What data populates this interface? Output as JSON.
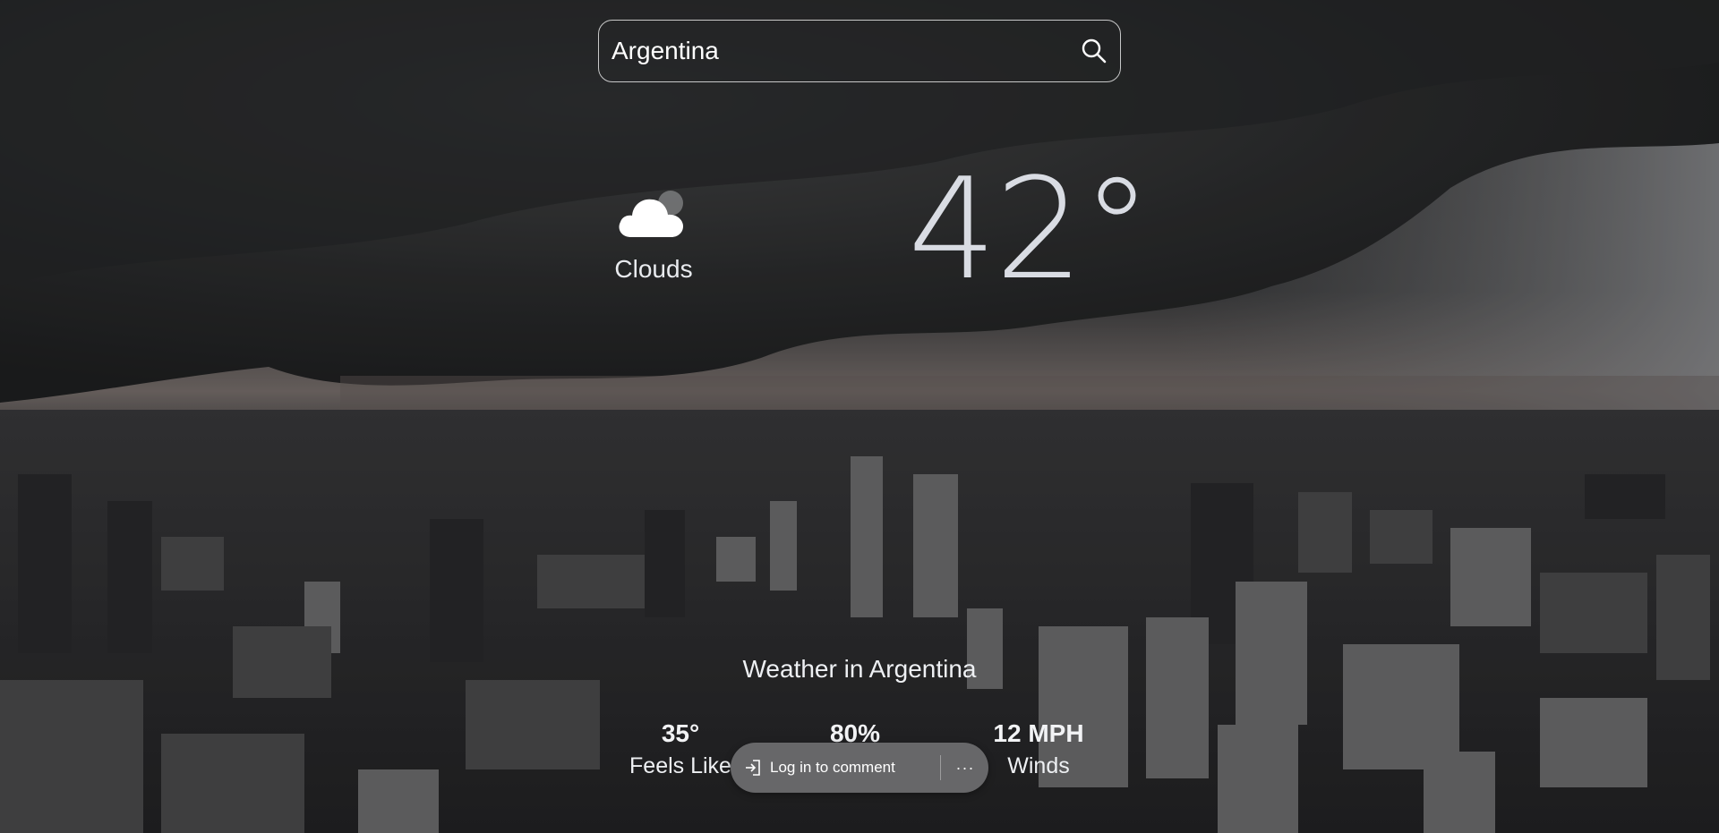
{
  "search": {
    "value": "Argentina",
    "placeholder": "Search"
  },
  "current": {
    "condition": "Clouds",
    "condition_icon": "cloud-icon",
    "temperature": "42°"
  },
  "summary": {
    "title": "Weather in Argentina",
    "stats": [
      {
        "value": "35°",
        "label": "Feels Like"
      },
      {
        "value": "80%",
        "label": ""
      },
      {
        "value": "12 MPH",
        "label": "Winds"
      }
    ]
  },
  "comment_bar": {
    "login_label": "Log in to comment",
    "login_icon": "login-icon",
    "more_icon": "more-icon",
    "more_label": "···"
  },
  "colors": {
    "text": "#ffffff",
    "temperature": "#d9dce3",
    "pill_bg": "#6e6e70"
  }
}
